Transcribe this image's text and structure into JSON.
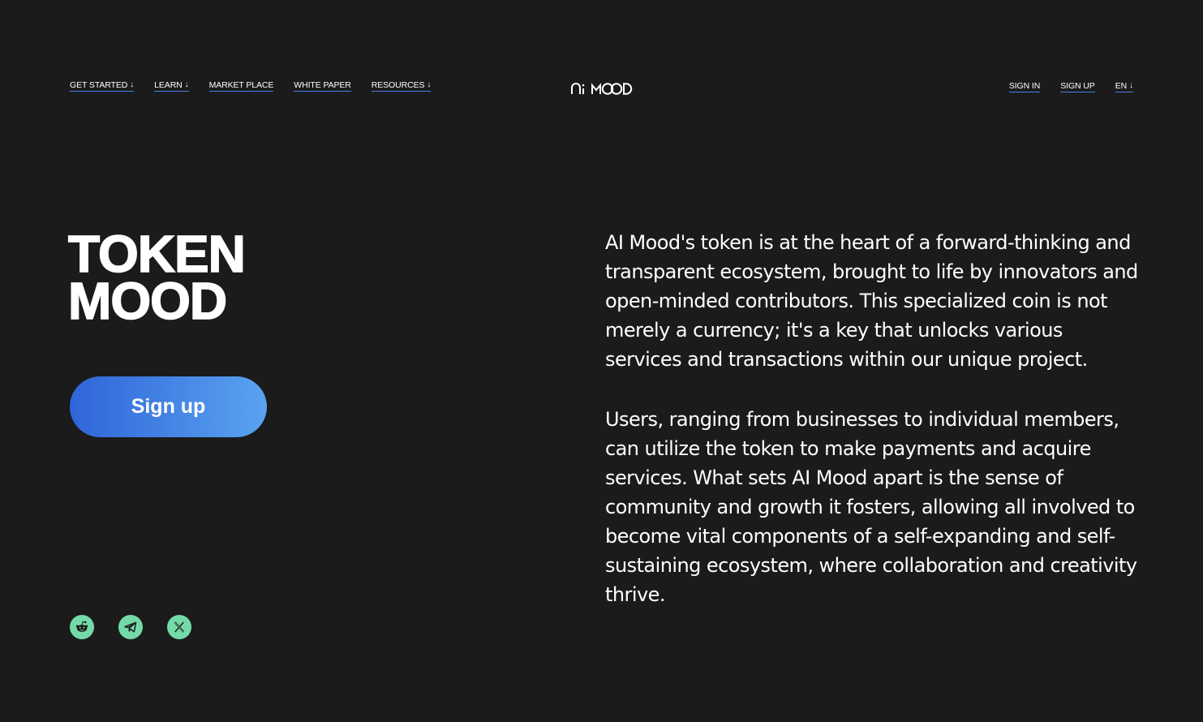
{
  "nav": {
    "left": [
      {
        "label": "GET STARTED",
        "dropdown": true
      },
      {
        "label": "LEARN",
        "dropdown": true
      },
      {
        "label": "MARKET PLACE",
        "dropdown": false
      },
      {
        "label": "WHITE PAPER",
        "dropdown": false
      },
      {
        "label": "RESOURCES",
        "dropdown": true
      }
    ],
    "right": {
      "sign_in": "SIGN IN",
      "sign_up": "SIGN UP",
      "language": "EN"
    },
    "dropdown_arrow": "↓"
  },
  "logo": {
    "text": "Ai MOOD"
  },
  "hero": {
    "title_line1": "TOKEN",
    "title_line2": "MOOD",
    "cta_label": "Sign up"
  },
  "description": {
    "paragraph1": "AI Mood's token is at the heart of a forward-thinking and transparent ecosystem, brought to life by innovators and open-minded contributors. This specialized coin is not merely a currency; it's a key that unlocks various services and transactions within our unique project.",
    "paragraph2": "Users, ranging from businesses to individual members, can utilize the token to make payments and acquire services. What sets AI Mood apart is the sense of community and growth it fosters, allowing all involved to become vital components of a self-expanding and self-sustaining ecosystem, where collaboration and creativity thrive."
  },
  "socials": [
    {
      "icon": "reddit-icon"
    },
    {
      "icon": "telegram-icon"
    },
    {
      "icon": "x-icon"
    }
  ],
  "colors": {
    "background": "#1b1b1c",
    "link_underline": "#4a7fe8",
    "cta_gradient_start": "#2f65d9",
    "cta_gradient_end": "#5aa3f0",
    "social_bg": "#74dba8"
  }
}
